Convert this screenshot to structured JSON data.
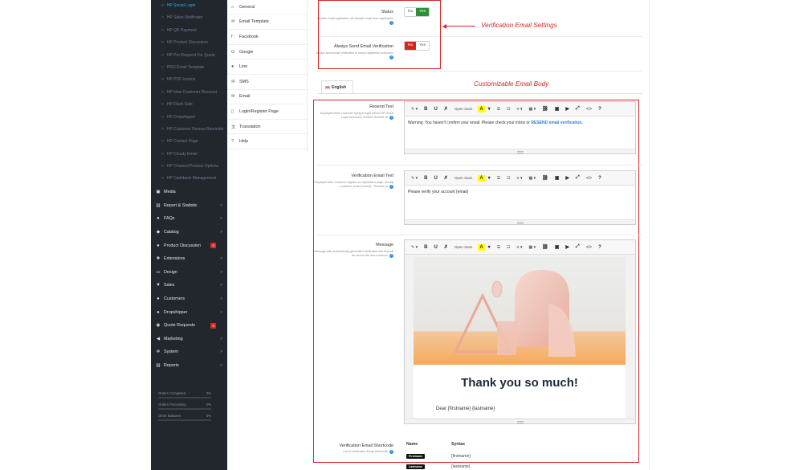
{
  "sidebar": {
    "sub_items": [
      {
        "label": "HP Social Login",
        "active": true
      },
      {
        "label": "HP Sales Notificator",
        "active": false
      },
      {
        "label": "HP QR Payment",
        "active": false
      },
      {
        "label": "HP Product Discussion",
        "active": false
      },
      {
        "label": "HP Pro Request For Quote",
        "active": false
      },
      {
        "label": "PRO Email Template",
        "active": false
      },
      {
        "label": "HP PDF Invoice",
        "active": false
      },
      {
        "label": "HP New Customer Discount",
        "active": false
      },
      {
        "label": "HP Flash Sale",
        "active": false
      },
      {
        "label": "HP Dropshipper",
        "active": false
      },
      {
        "label": "HP Customer Review Reminder",
        "active": false
      },
      {
        "label": "HP Contact Page",
        "active": false
      },
      {
        "label": "HP Cloudy Email",
        "active": false
      },
      {
        "label": "HP Chained Product Options",
        "active": false
      },
      {
        "label": "HP Cashback Management",
        "active": false
      }
    ],
    "menu_items": [
      {
        "label": "Media",
        "icon": "image-icon",
        "glyph": "▣",
        "chevron": false,
        "badge": ""
      },
      {
        "label": "Report & Statistic",
        "icon": "bar-chart-icon",
        "glyph": "▥",
        "chevron": true,
        "badge": ""
      },
      {
        "label": "FAQs",
        "icon": "comments-icon",
        "glyph": "●",
        "chevron": true,
        "badge": ""
      },
      {
        "label": "Catalog",
        "icon": "tag-icon",
        "glyph": "◆",
        "chevron": true,
        "badge": ""
      },
      {
        "label": "Product Discussion",
        "icon": "comments-icon",
        "glyph": "●",
        "chevron": false,
        "badge": "0"
      },
      {
        "label": "Extensions",
        "icon": "puzzle-icon",
        "glyph": "✚",
        "chevron": true,
        "badge": ""
      },
      {
        "label": "Design",
        "icon": "monitor-icon",
        "glyph": "▭",
        "chevron": true,
        "badge": ""
      },
      {
        "label": "Sales",
        "icon": "cart-icon",
        "glyph": "▼",
        "chevron": true,
        "badge": ""
      },
      {
        "label": "Customers",
        "icon": "user-icon",
        "glyph": "●",
        "chevron": true,
        "badge": ""
      },
      {
        "label": "Dropshipper",
        "icon": "users-icon",
        "glyph": "●",
        "chevron": true,
        "badge": ""
      },
      {
        "label": "Quote Requests",
        "icon": "globe-icon",
        "glyph": "◉",
        "chevron": false,
        "badge": "0"
      },
      {
        "label": "Marketing",
        "icon": "share-icon",
        "glyph": "◀",
        "chevron": true,
        "badge": ""
      },
      {
        "label": "System",
        "icon": "gear-icon",
        "glyph": "✲",
        "chevron": true,
        "badge": ""
      },
      {
        "label": "Reports",
        "icon": "bar-chart-icon",
        "glyph": "▥",
        "chevron": true,
        "badge": ""
      }
    ],
    "stats": [
      {
        "label": "Orders Completed",
        "value": "0%"
      },
      {
        "label": "Orders Processing",
        "value": "0%"
      },
      {
        "label": "Other Statuses",
        "value": "0%"
      }
    ]
  },
  "tabs": [
    {
      "label": "General",
      "icon": "home-icon",
      "glyph": "⌂"
    },
    {
      "label": "Email Template",
      "icon": "envelope-icon",
      "glyph": "✉"
    },
    {
      "label": "Facebook",
      "icon": "facebook-icon",
      "glyph": "f"
    },
    {
      "label": "Google",
      "icon": "google-icon",
      "glyph": "G"
    },
    {
      "label": "Line",
      "icon": "line-chat-icon",
      "glyph": "●"
    },
    {
      "label": "SMS",
      "icon": "envelope-icon",
      "glyph": "✉"
    },
    {
      "label": "Email",
      "icon": "envelope-icon",
      "glyph": "✉"
    },
    {
      "label": "Login/Register Page",
      "icon": "file-icon",
      "glyph": "▯"
    },
    {
      "label": "Translation",
      "icon": "translate-icon",
      "glyph": "文"
    },
    {
      "label": "Help",
      "icon": "question-circle-icon",
      "glyph": "?"
    }
  ],
  "status": {
    "label": "Status",
    "help": "Disable email registration will disable email form registration",
    "off": "No",
    "on": "Yes",
    "selected": "Yes"
  },
  "always_send": {
    "label": "Always Send Email Verification",
    "help": "Always send email verification to newly registered customers",
    "off": "No",
    "on": "Yes",
    "selected": "No"
  },
  "annotations": {
    "verification_settings": "Verification Email Settings",
    "customizable_body": "Customizable Email Body"
  },
  "language_tab": "English",
  "toolbar": {
    "font": "Open Sans",
    "buttons": [
      "✎ ▾",
      "B",
      "U",
      "✗",
      "A",
      "▾",
      "☰",
      "☷",
      "≡ ▾",
      "▦ ▾",
      "⛓",
      "▣",
      "▶",
      "⤢",
      "</>",
      "?"
    ]
  },
  "resend_text": {
    "label": "Resend Text",
    "help": "Displayed when customer trying to login before HP Social Login account is verified. Resend url",
    "content_prefix": "Warning: You haven't confirm your email. Please check your inbox or ",
    "content_link": "RESEND email verification."
  },
  "verification_text": {
    "label": "Verification Email Text",
    "help": "Displayed after customer register on registration page. {email} - customer email {resend} - Resend url",
    "content": "Please verify your account {email}"
  },
  "message": {
    "label": "Message",
    "help": "Message with automatically generated verification link that will be sent to the new customer",
    "headline": "Thank you so much!",
    "greeting": "Dear {firstname} {lastname}"
  },
  "shortcode": {
    "label": "Verification Email Shortcode",
    "help": "List of Verification Email Shortcode",
    "col_name": "Name",
    "col_syntax": "Syntax",
    "rows": [
      {
        "name": "Firstname",
        "syntax": "{firstname}"
      },
      {
        "name": "Lastname",
        "syntax": "{lastname}"
      }
    ]
  },
  "colors": {
    "sidebar_bg": "#22262d",
    "active_sub": "#28b2e8",
    "annotation_red": "#d9262a",
    "toggle_green": "#2f8f36",
    "toggle_red": "#cf2a1b"
  }
}
